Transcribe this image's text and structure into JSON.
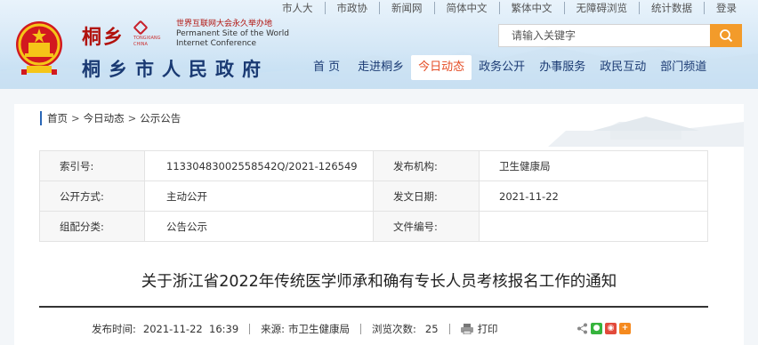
{
  "top_links": [
    "市人大",
    "市政协",
    "新闻网",
    "简体中文",
    "繁体中文",
    "无障碍浏览",
    "统计数据",
    "登录"
  ],
  "logo": {
    "city_cn": "桐乡",
    "city_small": "TONGXIANG CHINA",
    "wic_cn": "世界互联网大会永久举办地",
    "wic_en_line1": "Permanent Site of the World",
    "wic_en_line2": "Internet Conference",
    "gov_title": "桐乡市人民政府"
  },
  "search": {
    "placeholder": "请输入关键字"
  },
  "main_nav": [
    "首 页",
    "走进桐乡",
    "今日动态",
    "政务公开",
    "办事服务",
    "政民互动",
    "部门频道"
  ],
  "breadcrumb": [
    "首页",
    "今日动态",
    "公示公告"
  ],
  "meta": {
    "index_label": "索引号:",
    "index_value": "11330483002558542Q/2021-126549",
    "org_label": "发布机构:",
    "org_value": "卫生健康局",
    "open_label": "公开方式:",
    "open_value": "主动公开",
    "date_label": "发文日期:",
    "date_value": "2021-11-22",
    "group_label": "组配分类:",
    "group_value": "公告公示",
    "doc_label": "文件编号:",
    "doc_value": ""
  },
  "article": {
    "title": "关于浙江省2022年传统医学师承和确有专长人员考核报名工作的通知",
    "pub_label": "发布时间:",
    "pub_value": "2021-11-22  16:39",
    "source_label": "来源:",
    "source_value": "市卫生健康局",
    "views_label": "浏览次数:",
    "views_value": "25",
    "print_label": "打印"
  },
  "colors": {
    "accent": "#e44d26",
    "nav": "#1a3a73",
    "search_button": "#f39b2a",
    "logo_red": "#b1120d"
  }
}
